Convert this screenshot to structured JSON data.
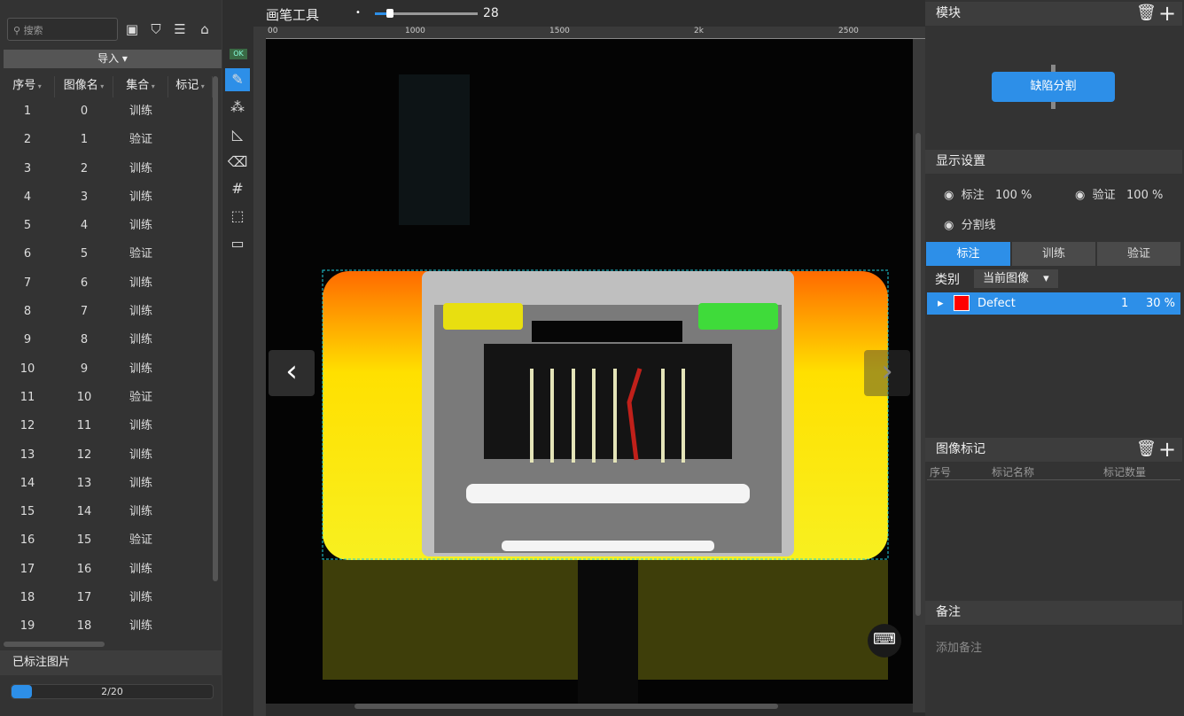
{
  "search": {
    "placeholder": "搜索"
  },
  "import_label": "导入",
  "table": {
    "columns": [
      "序号",
      "图像名",
      "集合",
      "标记"
    ],
    "rows": [
      [
        "1",
        "0",
        "训练"
      ],
      [
        "2",
        "1",
        "验证"
      ],
      [
        "3",
        "2",
        "训练"
      ],
      [
        "4",
        "3",
        "训练"
      ],
      [
        "5",
        "4",
        "训练"
      ],
      [
        "6",
        "5",
        "验证"
      ],
      [
        "7",
        "6",
        "训练"
      ],
      [
        "8",
        "7",
        "训练"
      ],
      [
        "9",
        "8",
        "训练"
      ],
      [
        "10",
        "9",
        "训练"
      ],
      [
        "11",
        "10",
        "验证"
      ],
      [
        "12",
        "11",
        "训练"
      ],
      [
        "13",
        "12",
        "训练"
      ],
      [
        "14",
        "13",
        "训练"
      ],
      [
        "15",
        "14",
        "训练"
      ],
      [
        "16",
        "15",
        "验证"
      ],
      [
        "17",
        "16",
        "训练"
      ],
      [
        "18",
        "17",
        "训练"
      ],
      [
        "19",
        "18",
        "训练"
      ]
    ]
  },
  "labeled": {
    "title": "已标注图片",
    "progress_text": "2/20",
    "progress": 0.1
  },
  "toolbar": {
    "ok": "OK"
  },
  "canvas": {
    "tool_title": "画笔工具",
    "brush_size": "28",
    "brush_fraction": 0.15,
    "ruler_ticks": [
      "00",
      "1000",
      "1500",
      "2k",
      "2500"
    ]
  },
  "module": {
    "title": "模块",
    "button": "缺陷分割"
  },
  "display": {
    "title": "显示设置",
    "label_name": "标注",
    "label_pct": "100 %",
    "verify_name": "验证",
    "verify_pct": "100 %",
    "split_name": "分割线"
  },
  "tabs": [
    "标注",
    "训练",
    "验证"
  ],
  "category": {
    "label": "类别",
    "selected": "当前图像"
  },
  "defect": {
    "name": "Defect",
    "count": "1",
    "pct": "30 %",
    "color": "#ff0000"
  },
  "image_marks": {
    "title": "图像标记",
    "columns": [
      "序号",
      "标记名称",
      "标记数量"
    ]
  },
  "notes": {
    "title": "备注",
    "placeholder": "添加备注"
  },
  "accent": "#2d8fe8"
}
